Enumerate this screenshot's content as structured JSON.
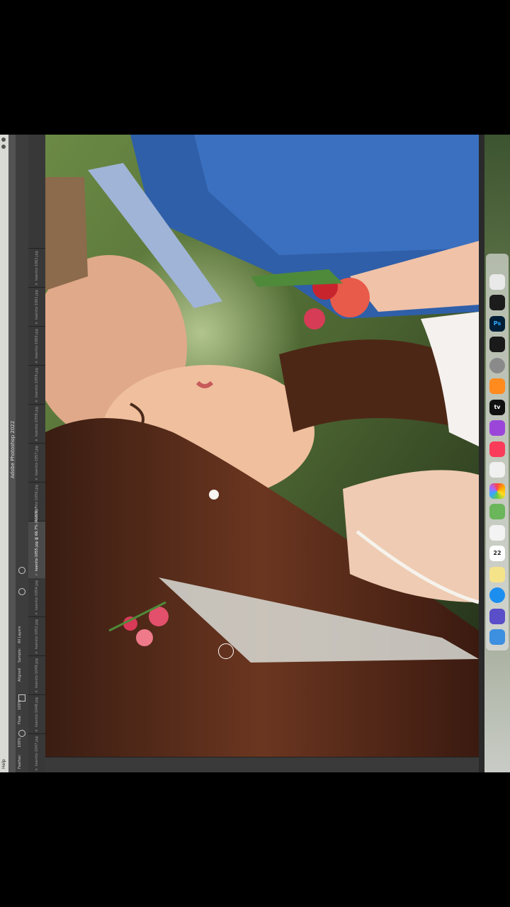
{
  "menubar": {
    "help": "Help"
  },
  "app": {
    "title": "Adobe Photoshop 2022"
  },
  "options": {
    "items": [
      "Feather:",
      "100%",
      "Flow:",
      "100%",
      "Aligned",
      "Sample:",
      "All Layers"
    ]
  },
  "tabs": [
    {
      "label": "koenitz-1047.jpg",
      "active": false
    },
    {
      "label": "koenitz-1048.jpg",
      "active": false
    },
    {
      "label": "koenitz-1049.jpg",
      "active": false
    },
    {
      "label": "koenitz-1052.jpg",
      "active": false
    },
    {
      "label": "koenitz-1054.jpg",
      "active": false
    },
    {
      "label": "koenitz-1055.jpg @ 66.7% (RGB/8) *",
      "active": true
    },
    {
      "label": "koenitz-1056.jpg",
      "active": false
    },
    {
      "label": "koenitz-1057.jpg",
      "active": false
    },
    {
      "label": "koenitz-1058.jpg",
      "active": false
    },
    {
      "label": "koenitz-1059.jpg",
      "active": false
    },
    {
      "label": "koenitz-1060.jpg",
      "active": false
    },
    {
      "label": "koenitz-1061.jpg",
      "active": false
    },
    {
      "label": "koenitz-1062.jpg",
      "active": false
    }
  ],
  "dock": {
    "calendar_day": "22",
    "ps_label": "Ps",
    "tv_label": "tv",
    "icons": [
      "finder-icon",
      "siri-icon",
      "safari-icon",
      "notes-icon",
      "calendar-icon",
      "reminders-icon",
      "maps-icon",
      "photos-icon",
      "news-icon",
      "music-icon",
      "podcasts-icon",
      "appletv-icon",
      "books-icon",
      "system-preferences-icon",
      "lightroom-icon",
      "photoshop-icon",
      "activity-icon",
      "trash-icon"
    ]
  },
  "colors": {
    "ps_bg": "#535353",
    "ps_tab": "#383838",
    "accent_blue": "#31a8ff"
  }
}
